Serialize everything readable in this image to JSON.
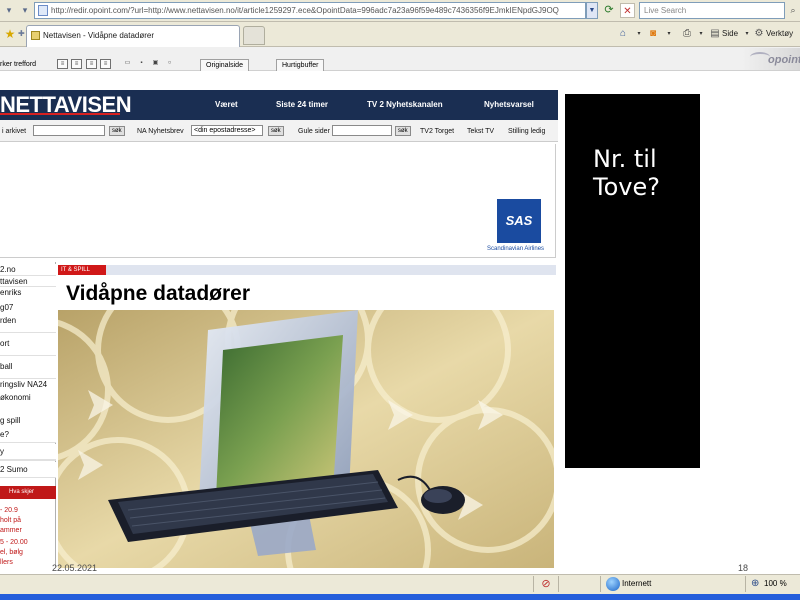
{
  "browser": {
    "url": "http://redir.opoint.com/?url=http://www.nettavisen.no/it/article1259297.ece&OpointData=996adc7a23a96f59e489c7436356f9EJmkIENpdGJ9OQ",
    "search_placeholder": "Live Search",
    "tab_title": "Nettavisen - Vidåpne datadører",
    "commands": {
      "side": "Side",
      "tools": "Verktøy"
    }
  },
  "opoint_toolbar": {
    "hits_label": "rker trefford",
    "original_tab": "Originalside",
    "cache_tab": "Hurtigbuffer",
    "logo": "opoint"
  },
  "site": {
    "logo": "NETTAVISEN",
    "nav": [
      "Været",
      "Siste 24 timer",
      "TV 2 Nyhetskanalen",
      "Nyhetsvarsel"
    ],
    "search": {
      "label_left": "i arkivet",
      "btn": "søk",
      "newsletter_label": "NA Nyhetsbrev",
      "email_placeholder": "<din epostadresse>",
      "btn2": "søk",
      "gule_sider": "Gule sider",
      "btn3": "søk",
      "links": [
        "TV2 Torget",
        "Tekst TV",
        "Stilling ledig"
      ]
    },
    "ad": {
      "logo": "SAS",
      "tagline": "Scandinavian Airlines"
    },
    "left_nav": [
      "2.no",
      "ttavisen",
      "enriks",
      "g07",
      "rden",
      "ort",
      "ball",
      "ringsliv NA24",
      "økonomi",
      "g spill",
      "e?",
      "y",
      "2 Sumo"
    ],
    "tv_guide": {
      "label": "Hva skjer",
      "items": [
        "- 20.9",
        "holt på",
        "ammer",
        "5 - 20.00",
        "el, bølg",
        "llers"
      ]
    },
    "article": {
      "section": "IT & SPILL",
      "headline": "Vidåpne datadører"
    }
  },
  "slide": {
    "note": "Nr. til Tove?",
    "date": "22.05.2021",
    "page_number": "18"
  },
  "status": {
    "zone": "Internett",
    "zoom": "100 %"
  }
}
